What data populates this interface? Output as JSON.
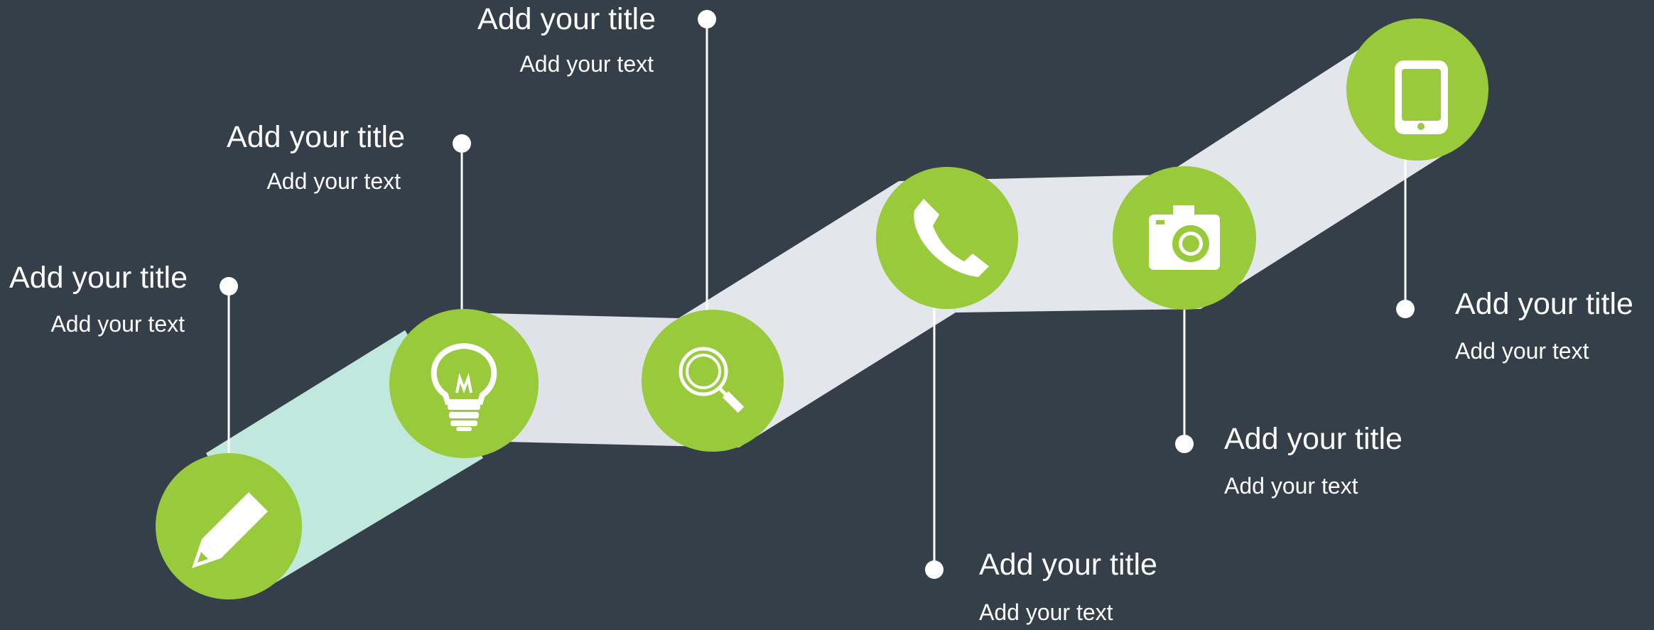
{
  "colors": {
    "background": "#353f4a",
    "node": "#99ca3c",
    "band_gray": "#e3e7eb",
    "band_mint": "#c1e8dd",
    "connector": "#ffffff",
    "icon": "#ffffff"
  },
  "steps": [
    {
      "title": "Add your title",
      "text": "Add your text",
      "icon": "pencil-icon"
    },
    {
      "title": "Add your title",
      "text": "Add your text",
      "icon": "lightbulb-icon"
    },
    {
      "title": "Add your title",
      "text": "Add your text",
      "icon": "magnifier-icon"
    },
    {
      "title": "Add your title",
      "text": "Add your text",
      "icon": "phone-icon"
    },
    {
      "title": "Add your title",
      "text": "Add your text",
      "icon": "camera-icon"
    },
    {
      "title": "Add your title",
      "text": "Add your text",
      "icon": "mobile-device-icon"
    }
  ]
}
